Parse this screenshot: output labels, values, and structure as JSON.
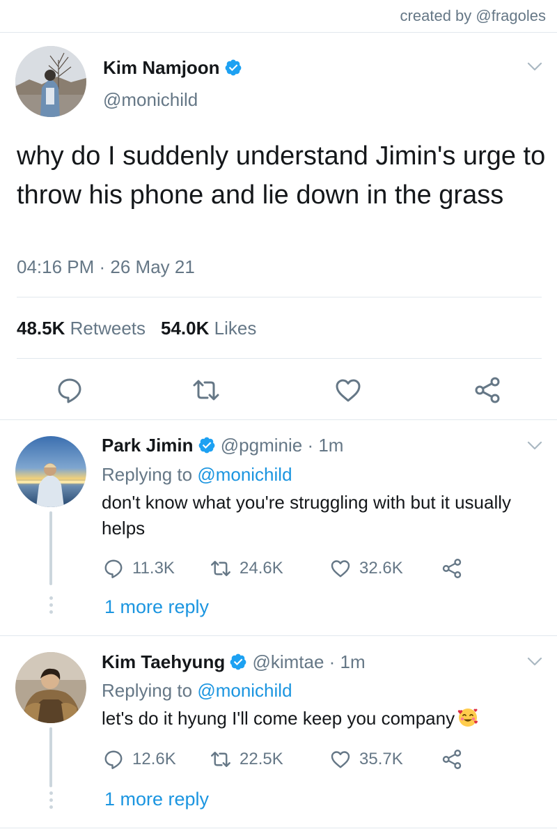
{
  "credit": "created by @fragoles",
  "tweet": {
    "author_name": "Kim Namjoon",
    "author_handle": "@monichild",
    "text": "why do I suddenly understand Jimin's urge to throw his phone and lie down in the grass",
    "timestamp": "04:16 PM · 26 May 21",
    "retweets_count": "48.5K",
    "retweets_label": "Retweets",
    "likes_count": "54.0K",
    "likes_label": "Likes"
  },
  "replies": [
    {
      "author_name": "Park Jimin",
      "author_handle": "@pgminie",
      "time": "· 1m",
      "replying_prefix": "Replying to",
      "replying_handle": "@monichild",
      "text": "don't know what you're struggling with but it usually helps",
      "reply_count": "11.3K",
      "retweet_count": "24.6K",
      "like_count": "32.6K",
      "more_replies": "1 more reply"
    },
    {
      "author_name": "Kim Taehyung",
      "author_handle": "@kimtae",
      "time": "· 1m",
      "replying_prefix": "Replying to",
      "replying_handle": "@monichild",
      "text": "let's do it hyung I'll come keep you company",
      "emoji": "smiling-face-with-hearts",
      "reply_count": "12.6K",
      "retweet_count": "22.5K",
      "like_count": "35.7K",
      "more_replies": "1 more reply"
    }
  ],
  "colors": {
    "accent": "#1b95e0",
    "verified": "#1da1f2",
    "muted": "#657786",
    "divider": "#e1e8ed"
  },
  "icons": [
    "verified-badge-icon",
    "chevron-down-icon",
    "reply-icon",
    "retweet-icon",
    "like-icon",
    "share-icon"
  ]
}
